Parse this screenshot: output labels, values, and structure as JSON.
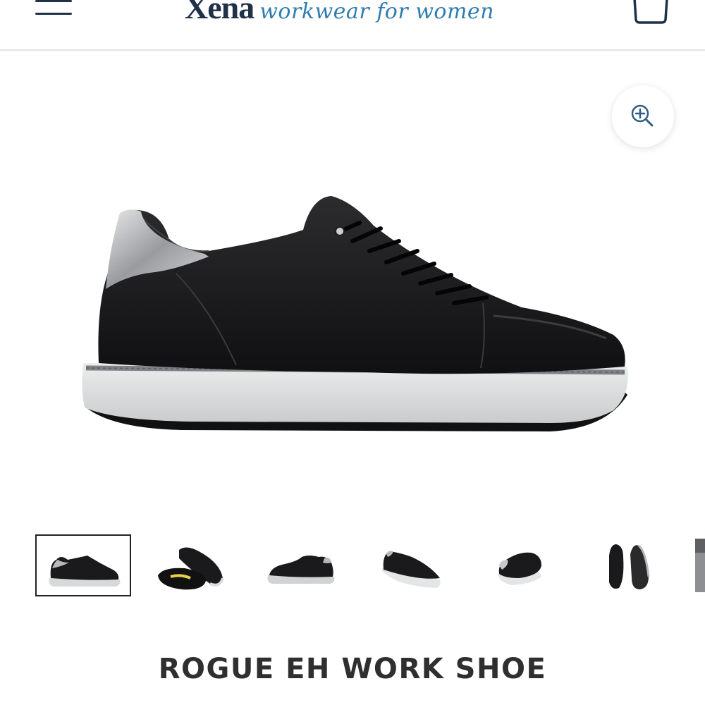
{
  "header": {
    "brand_name": "Xena",
    "brand_tagline": "workwear for women",
    "menu_icon": "hamburger-menu-icon",
    "cart_icon": "shopping-bag-icon"
  },
  "gallery": {
    "zoom_icon": "zoom-in-icon",
    "main_image": "black leather sneaker with silver heel tab and grey sole",
    "thumbnails": [
      {
        "view": "side",
        "selected": true
      },
      {
        "view": "sole"
      },
      {
        "view": "side-alt"
      },
      {
        "view": "three-quarter"
      },
      {
        "view": "heel-angle"
      },
      {
        "view": "top-pair"
      },
      {
        "view": "partial"
      }
    ]
  },
  "product": {
    "title": "ROGUE EH WORK SHOE"
  },
  "colors": {
    "brand_navy": "#1f3148",
    "brand_blue": "#2f7db0",
    "title_text": "#2f2f2f"
  }
}
